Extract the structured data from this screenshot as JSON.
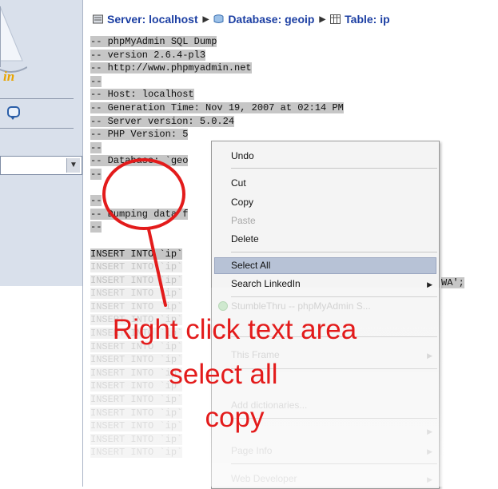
{
  "sidebar": {
    "logo_text": "in"
  },
  "breadcrumb": {
    "server": "Server: localhost",
    "database": "Database: geoip",
    "table": "Table: ip"
  },
  "sql_lines": [
    "-- phpMyAdmin SQL Dump",
    "-- version 2.6.4-pl3",
    "-- http://www.phpmyadmin.net",
    "--",
    "-- Host: localhost",
    "-- Generation Time: Nov 19, 2007 at 02:14 PM",
    "-- Server version: 5.0.24",
    "-- PHP Version: 5",
    "--",
    "-- Database: `geo",
    "--",
    "",
    "--",
    "-- Dumping data f",
    "--",
    "",
    "INSERT INTO `ip`"
  ],
  "sql_faded_lines": [
    "INSERT INTO `ip`",
    "INSERT INTO `ip`",
    "INSERT INTO `ip`",
    "INSERT INTO `ip`",
    "INSERT INTO `ip`",
    "INSERT INTO `ip`",
    "INSERT INTO `ip`",
    "INSERT INTO `ip`",
    "INSERT INTO `ip`",
    "INSERT INTO `ip`",
    "INSERT INTO `ip`",
    "INSERT INTO `ip`",
    "INSERT INTO `ip`",
    "INSERT INTO `ip`",
    "INSERT INTO `ip`"
  ],
  "sql_right_tail": "WA';",
  "context_menu": {
    "undo": "Undo",
    "cut": "Cut",
    "copy": "Copy",
    "paste": "Paste",
    "delete": "Delete",
    "select_all": "Select All",
    "search_linkedin": "Search LinkedIn",
    "stumbleupon": "StumbleThru -- phpMyAdmin S...",
    "this_frame": "This Frame",
    "add_dictionaries": "Add dictionaries...",
    "page_info": "Page Info",
    "web_developer": "Web Developer"
  },
  "annotation": {
    "line1": "Right click text area",
    "line2": "select all",
    "line3": "copy"
  },
  "colors": {
    "annotation_red": "#e31b1b",
    "link_blue": "#1c3fa3",
    "highlight": "#b7c2d6"
  }
}
